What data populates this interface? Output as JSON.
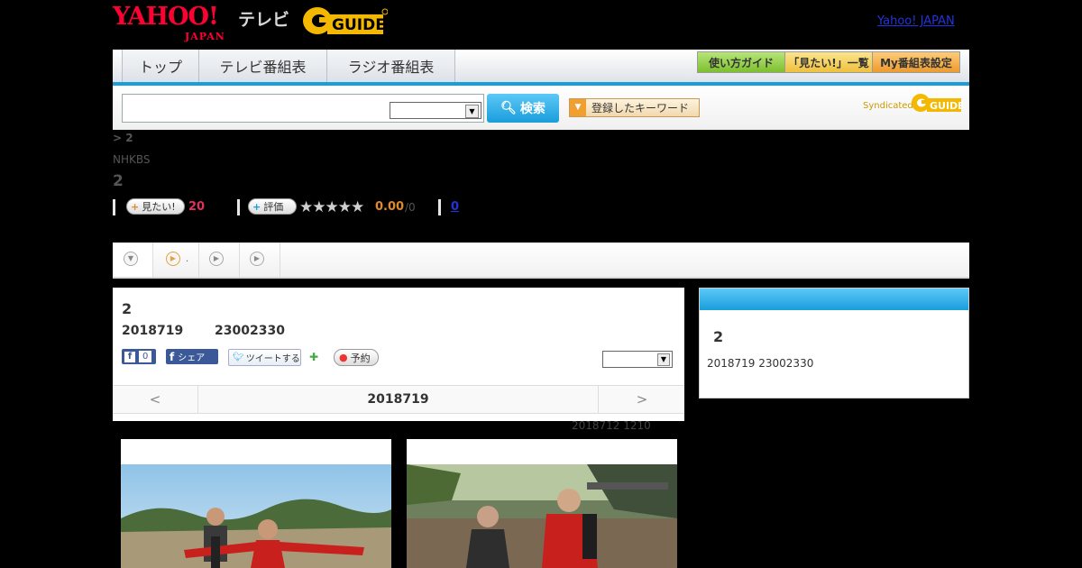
{
  "header": {
    "yahoo_logo": "YAHOO!",
    "yahoo_logo_sub": "JAPAN",
    "tv_label": "テレビ",
    "gguide_logo": "GUIDE",
    "yahoo_japan_link": "Yahoo! JAPAN"
  },
  "nav": {
    "tabs": [
      {
        "label": "トップ"
      },
      {
        "label": "テレビ番組表"
      },
      {
        "label": "ラジオ番組表"
      }
    ],
    "buttons": [
      {
        "label": "使い方ガイド",
        "color": "#8fce3c"
      },
      {
        "label": "「見たい!」一覧",
        "color": "#f2c94c"
      },
      {
        "label": "My番組表設定",
        "color": "#f2a23c"
      }
    ]
  },
  "search": {
    "input_value": "",
    "select_value": "",
    "button_label": "検索",
    "keyword_button_label": "登録したキーワード",
    "syndicated_label": "Syndicated",
    "syndicated_logo": "GUIDE"
  },
  "program": {
    "breadcrumb": " > 2",
    "channel": "NHKBS",
    "title": "2",
    "want_label": "見たい!",
    "want_count": "20",
    "rate_label": "評価",
    "rating_value": "0.00",
    "rating_suffix": "/0",
    "review_count": "0",
    "rating_stars_filled": 0,
    "rating_stars_total": 5
  },
  "subtabs": [
    {
      "label": ""
    },
    {
      "label": "."
    },
    {
      "label": ""
    },
    {
      "label": ""
    }
  ],
  "main_panel": {
    "title": "2",
    "date": "2018719",
    "time": "23002330",
    "like_count": "0",
    "share_label": "シェア",
    "tweet_label": "ツイートする",
    "reserve_label": "予約",
    "select_value": "",
    "prev_label": "<",
    "current_date": "2018719",
    "next_label": ">"
  },
  "updated_text": "2018712  1210",
  "side_panel": {
    "title": "2",
    "datetime": "2018719  23002330"
  },
  "colors": {
    "accent_blue": "#1a9ddb",
    "want_pink": "#e0315c",
    "rating_orange": "#e08a2b",
    "link_blue": "#2233dd"
  }
}
